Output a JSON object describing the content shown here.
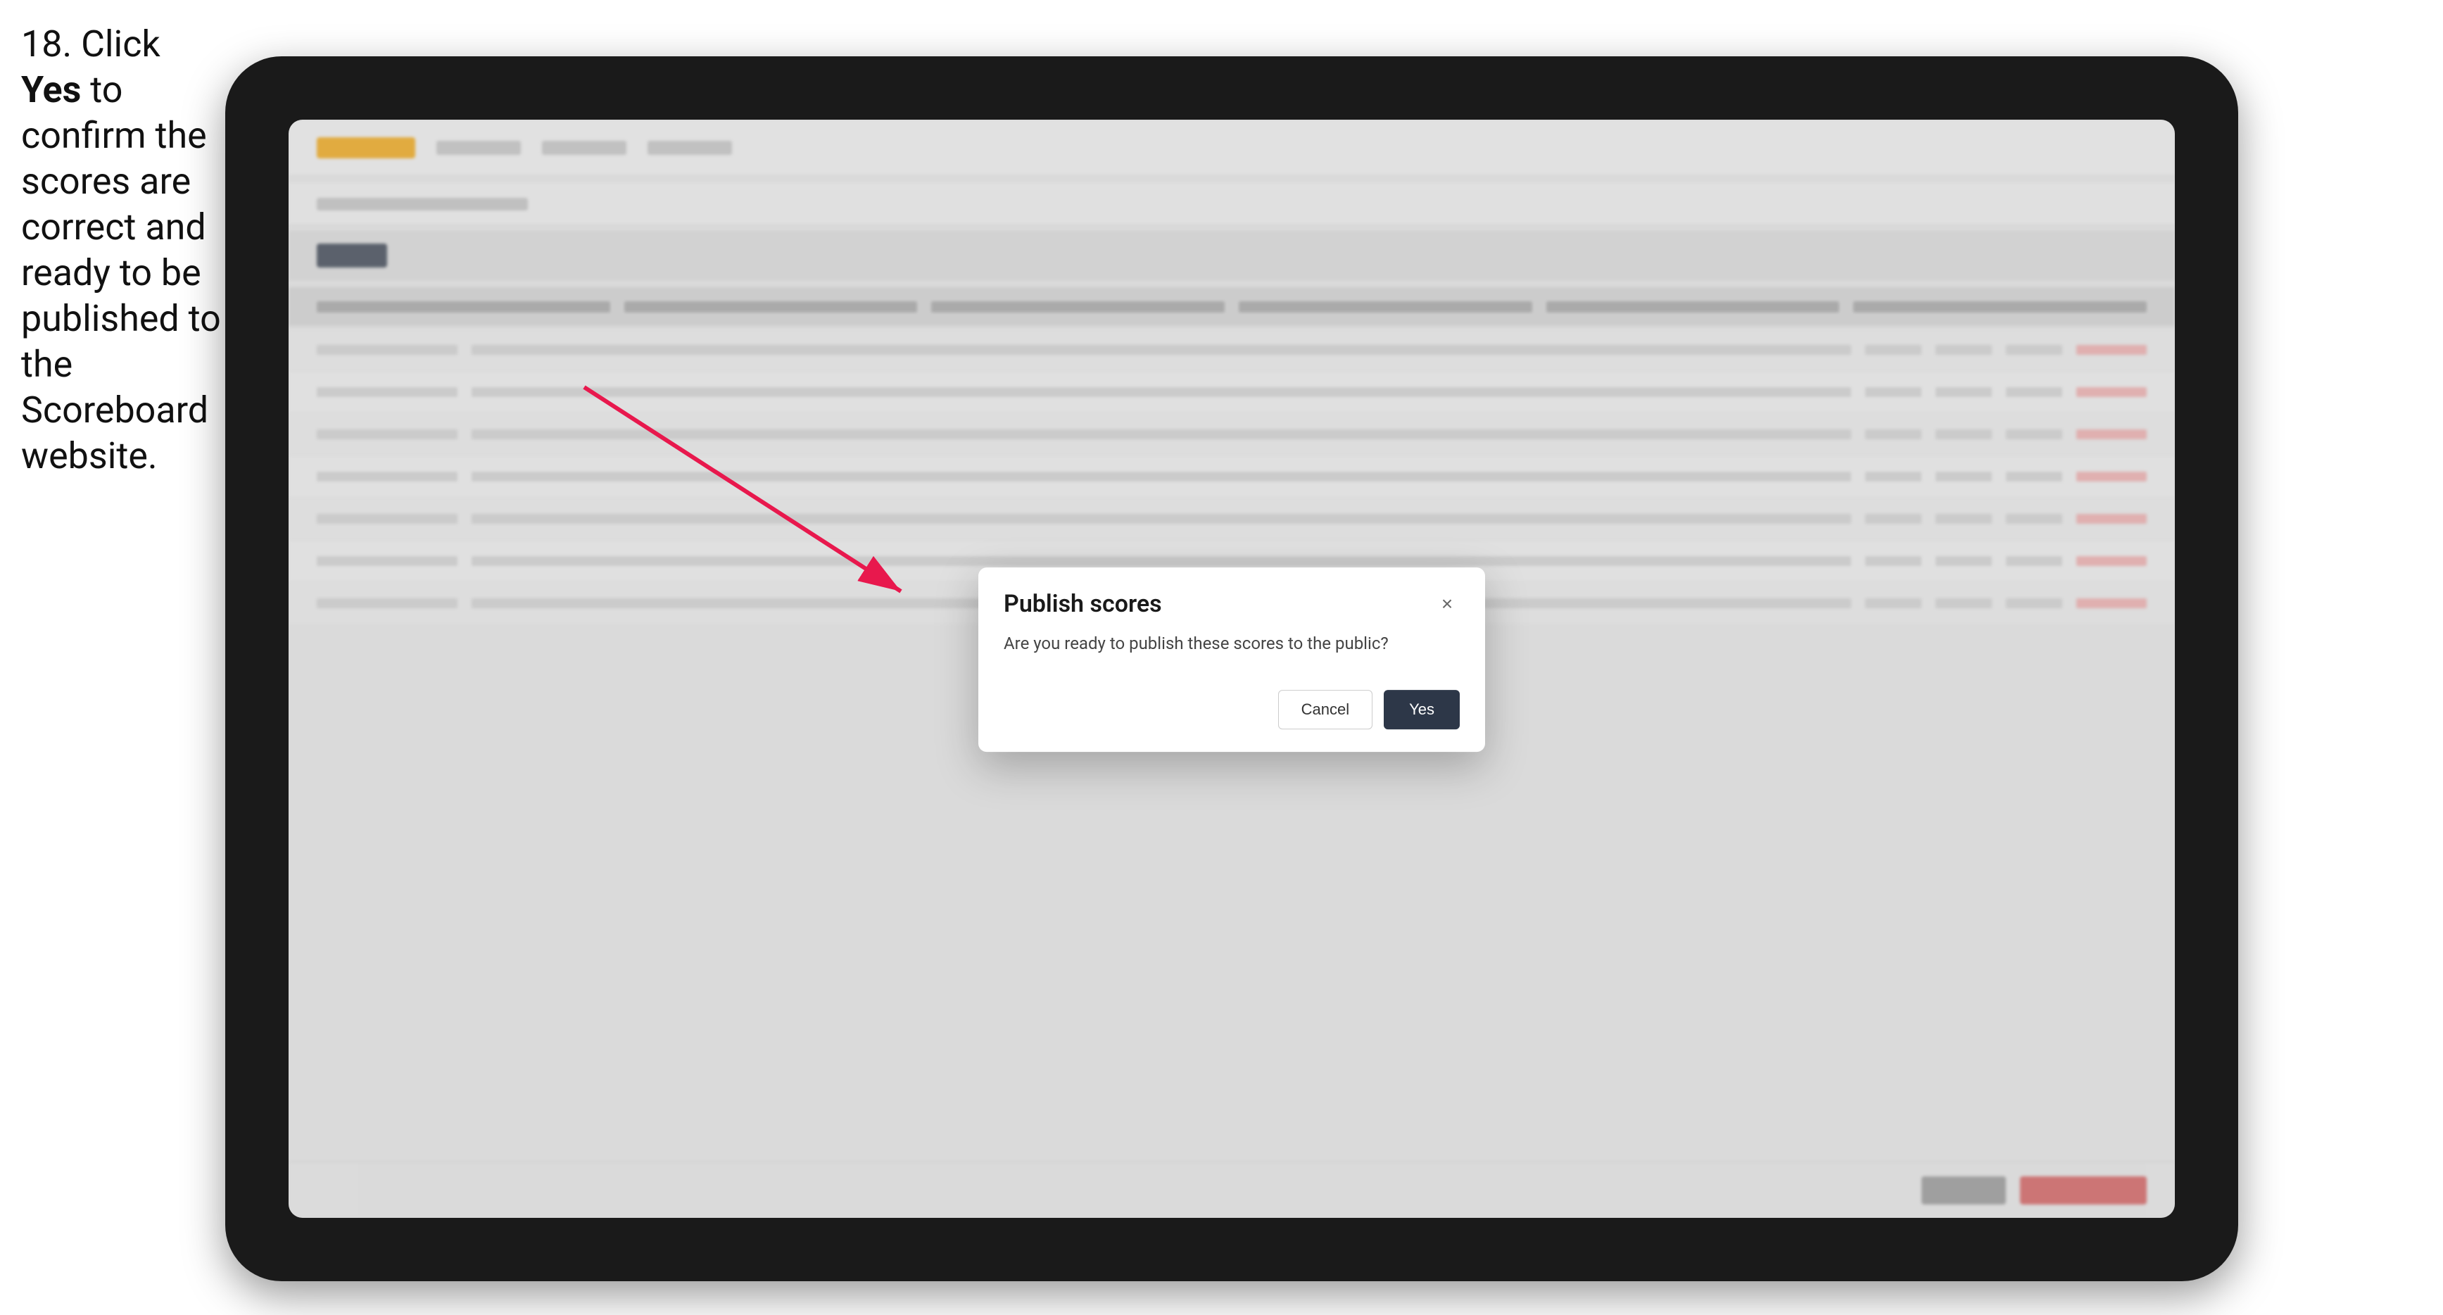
{
  "instruction": {
    "step_number": "18.",
    "text_parts": [
      "Click ",
      "Yes",
      " to confirm the scores are correct and ready to be published to the Scoreboard website."
    ]
  },
  "dialog": {
    "title": "Publish scores",
    "message": "Are you ready to publish these scores to the public?",
    "close_icon": "×",
    "cancel_label": "Cancel",
    "yes_label": "Yes"
  },
  "background": {
    "rows": [
      {
        "cells": 6
      },
      {
        "cells": 6
      },
      {
        "cells": 6
      },
      {
        "cells": 6
      },
      {
        "cells": 6
      },
      {
        "cells": 6
      },
      {
        "cells": 6
      },
      {
        "cells": 6
      }
    ]
  }
}
